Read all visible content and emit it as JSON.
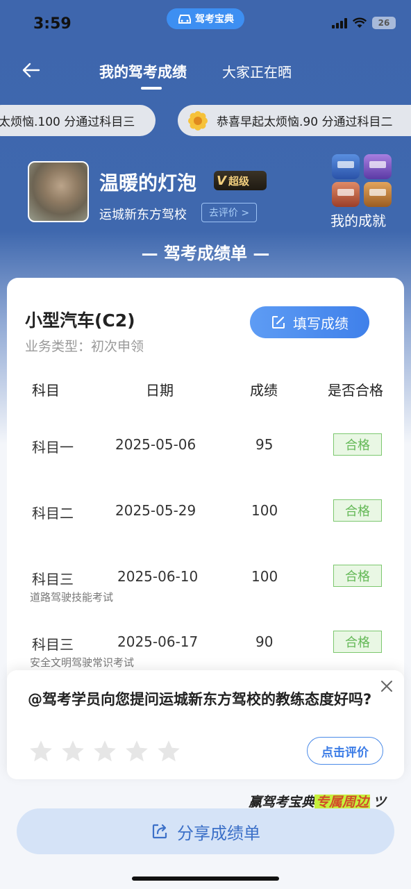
{
  "status_bar": {
    "time": "3:59",
    "app_badge": "驾考宝典",
    "battery": "26"
  },
  "nav": {
    "tabs": [
      {
        "label": "我的驾考成绩"
      },
      {
        "label": "大家正在晒"
      }
    ]
  },
  "ticker": [
    {
      "text": "太烦恼.100 分通过科目三"
    },
    {
      "text": "恭喜早起太烦恼.90 分通过科目二"
    }
  ],
  "profile": {
    "name": "温暖的灯泡",
    "vip_label": "超级",
    "school": "运城新东方驾校",
    "rate_label": "去评价 >",
    "achievements_label": "我的成就"
  },
  "section_title": "— 驾考成绩单 —",
  "card": {
    "vehicle": "小型汽车(C2)",
    "business_type": "业务类型：初次申领",
    "fill_button": "填写成绩",
    "headers": [
      "科目",
      "日期",
      "成绩",
      "是否合格"
    ],
    "rows": [
      {
        "subject": "科目一",
        "sub": "",
        "date": "2025-05-06",
        "score": "95",
        "result": "合格"
      },
      {
        "subject": "科目二",
        "sub": "",
        "date": "2025-05-29",
        "score": "100",
        "result": "合格"
      },
      {
        "subject": "科目三",
        "sub": "道路驾驶技能考试",
        "date": "2025-06-10",
        "score": "100",
        "result": "合格"
      },
      {
        "subject": "科目三",
        "sub": "安全文明驾驶常识考试",
        "date": "2025-06-17",
        "score": "90",
        "result": "合格"
      }
    ]
  },
  "popup": {
    "question": "@驾考学员向您提问运城新东方驾校的教练态度好吗?",
    "stars": 5,
    "rate_button": "点击评价"
  },
  "promo": {
    "prefix": "赢驾考宝典",
    "highlight": "专属周边",
    "suffix": "ツ"
  },
  "share_button": "分享成绩单",
  "colors": {
    "primary": "#3f68ae",
    "accent": "#3f80ea",
    "pass": "#63b856"
  }
}
